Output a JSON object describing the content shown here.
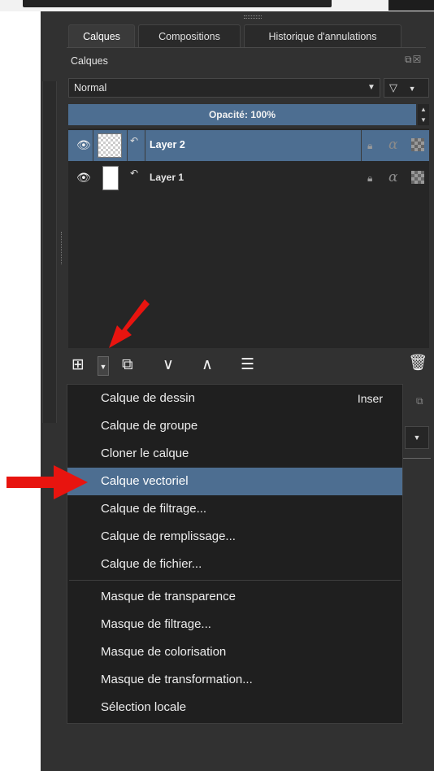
{
  "colors": {
    "panel_bg": "#313131",
    "selection": "#4d6e91",
    "annotation_arrow": "#e8140f"
  },
  "tabs": [
    {
      "label": "Calques",
      "active": true
    },
    {
      "label": "Compositions",
      "active": false
    },
    {
      "label": "Historique d'annulations",
      "active": false
    }
  ],
  "docker": {
    "title": "Calques",
    "icons": [
      "float-icon",
      "close-icon"
    ]
  },
  "blend_mode": {
    "value": "Normal"
  },
  "filter": {
    "icon": "filter-icon"
  },
  "opacity": {
    "label": "Opacité:  100%"
  },
  "layers": [
    {
      "name": "Layer 2",
      "selected": true,
      "visible": true,
      "thumb": "transparent"
    },
    {
      "name": "Layer 1",
      "selected": false,
      "visible": true,
      "thumb": "white"
    }
  ],
  "toolbar": {
    "icons": [
      "add-layer-icon",
      "dropdown-arrow-icon",
      "duplicate-layer-icon",
      "move-down-icon",
      "move-up-icon",
      "layer-properties-icon",
      "delete-layer-icon"
    ]
  },
  "menu": {
    "items": [
      {
        "label": "Calque de dessin",
        "shortcut": "Inser"
      },
      {
        "label": "Calque de groupe"
      },
      {
        "label": "Cloner le calque"
      },
      {
        "label": "Calque vectoriel",
        "highlighted": true
      },
      {
        "label": "Calque de filtrage..."
      },
      {
        "label": "Calque de remplissage..."
      },
      {
        "label": "Calque de fichier..."
      },
      {
        "label": "Masque de transparence"
      },
      {
        "label": "Masque de filtrage..."
      },
      {
        "label": "Masque de colorisation"
      },
      {
        "label": "Masque de transformation..."
      },
      {
        "label": "Sélection locale"
      }
    ]
  }
}
